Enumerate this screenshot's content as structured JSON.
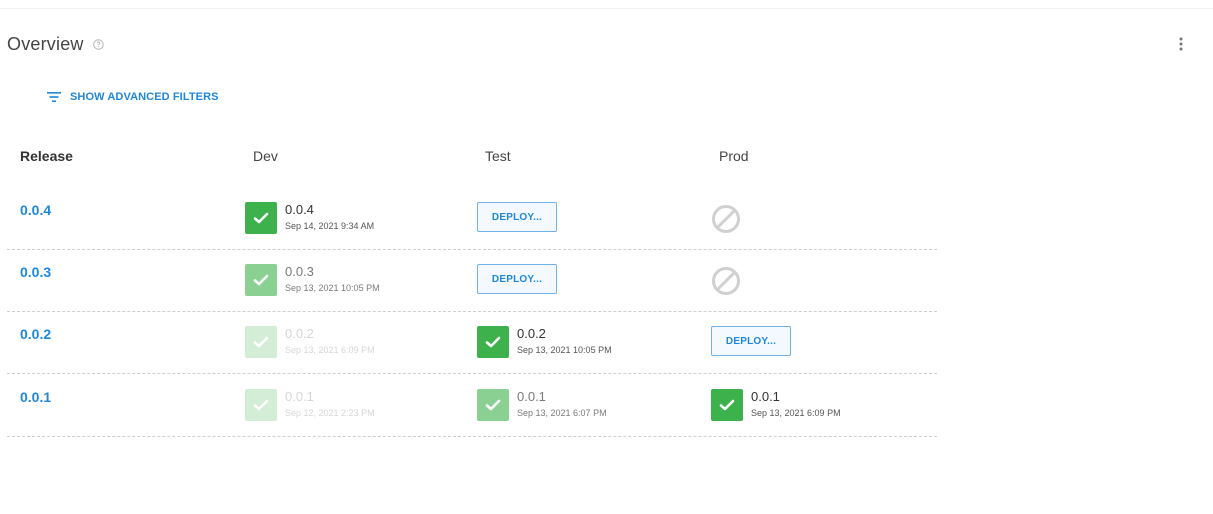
{
  "overview": {
    "title": "Overview",
    "filters_label": "SHOW ADVANCED FILTERS"
  },
  "columns": {
    "release": "Release",
    "dev": "Dev",
    "test": "Test",
    "prod": "Prod"
  },
  "rows": [
    {
      "release": "0.0.4",
      "dev": {
        "state": "deployed",
        "version": "0.0.4",
        "date": "Sep 14, 2021 9:34 AM"
      },
      "test": {
        "state": "deploy",
        "label": "DEPLOY..."
      },
      "prod": {
        "state": "blocked"
      }
    },
    {
      "release": "0.0.3",
      "dev": {
        "state": "deployed",
        "version": "0.0.3",
        "date": "Sep 13, 2021 10:05 PM"
      },
      "test": {
        "state": "deploy",
        "label": "DEPLOY..."
      },
      "prod": {
        "state": "blocked"
      }
    },
    {
      "release": "0.0.2",
      "dev": {
        "state": "deployed",
        "version": "0.0.2",
        "date": "Sep 13, 2021 6:09 PM"
      },
      "test": {
        "state": "deployed",
        "version": "0.0.2",
        "date": "Sep 13, 2021 10:05 PM"
      },
      "prod": {
        "state": "deploy",
        "label": "DEPLOY..."
      }
    },
    {
      "release": "0.0.1",
      "dev": {
        "state": "deployed",
        "version": "0.0.1",
        "date": "Sep 12, 2021 2:23 PM"
      },
      "test": {
        "state": "deployed",
        "version": "0.0.1",
        "date": "Sep 13, 2021 6:07 PM"
      },
      "prod": {
        "state": "deployed",
        "version": "0.0.1",
        "date": "Sep 13, 2021 6:09 PM"
      }
    }
  ],
  "colors": {
    "accent": "#1f87d8",
    "success": "#3db14b",
    "blocked": "#d0d0d0"
  },
  "icons": {
    "help": "help-circle-icon",
    "more": "more-vertical-icon",
    "filter": "filter-lines-icon",
    "check": "check-icon",
    "blocked": "blocked-circle-icon"
  }
}
